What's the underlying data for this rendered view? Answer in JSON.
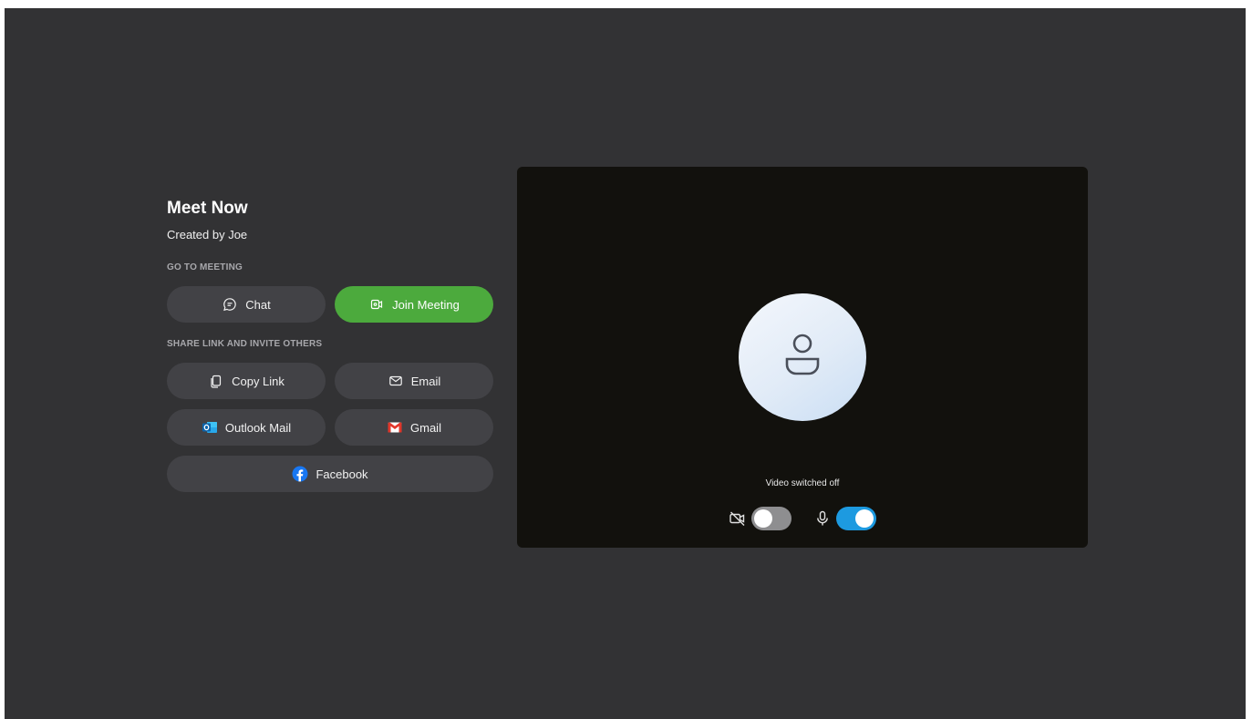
{
  "meeting": {
    "title": "Meet Now",
    "creator": "Created by Joe"
  },
  "go_to_meeting": {
    "label": "GO TO MEETING",
    "chat_label": "Chat",
    "join_label": "Join Meeting"
  },
  "share": {
    "label": "SHARE LINK AND INVITE OTHERS",
    "copy_link_label": "Copy Link",
    "email_label": "Email",
    "outlook_label": "Outlook Mail",
    "gmail_label": "Gmail",
    "facebook_label": "Facebook"
  },
  "preview": {
    "status_text": "Video switched off",
    "video_enabled": false,
    "mic_enabled": true
  },
  "icons": {
    "chat": "chat-bubble-icon",
    "join": "video-camera-icon",
    "copy": "copy-icon",
    "email": "envelope-icon",
    "outlook": "outlook-icon",
    "gmail": "gmail-icon",
    "facebook": "facebook-icon",
    "avatar": "person-icon",
    "camera_off": "camera-off-icon",
    "microphone": "microphone-icon"
  },
  "colors": {
    "background": "#323234",
    "button": "#424246",
    "join_button": "#4caa3d",
    "video_panel": "#12110d",
    "toggle_on": "#1d9ae0",
    "toggle_off": "#8e8e90"
  }
}
